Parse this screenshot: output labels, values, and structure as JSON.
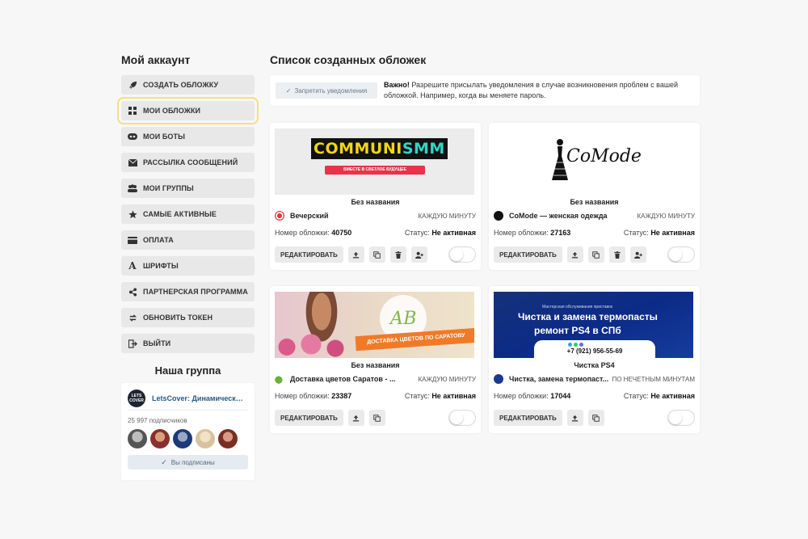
{
  "sidebar": {
    "title": "Мой аккаунт",
    "items": [
      {
        "label": "СОЗДАТЬ ОБЛОЖКУ",
        "icon": "rocket-icon"
      },
      {
        "label": "МОИ ОБЛОЖКИ",
        "icon": "grid-icon"
      },
      {
        "label": "МОИ БОТЫ",
        "icon": "bot-icon"
      },
      {
        "label": "РАССЫЛКА СООБЩЕНИЙ",
        "icon": "envelope-icon"
      },
      {
        "label": "МОИ ГРУППЫ",
        "icon": "users-icon"
      },
      {
        "label": "САМЫЕ АКТИВНЫЕ",
        "icon": "star-icon"
      },
      {
        "label": "ОПЛАТА",
        "icon": "card-icon"
      },
      {
        "label": "ШРИФТЫ",
        "icon": "font-icon"
      },
      {
        "label": "ПАРТНЕРСКАЯ ПРОГРАММА",
        "icon": "share-icon"
      },
      {
        "label": "ОБНОВИТЬ ТОКЕН",
        "icon": "refresh-icon"
      },
      {
        "label": "ВЫЙТИ",
        "icon": "logout-icon"
      }
    ],
    "active_index": 1
  },
  "group": {
    "title": "Наша группа",
    "logo_text": "LETS COVER",
    "name": "LetsCover: Динамические обложки",
    "subscribers": "25 997 подписчиков",
    "subscribed_label": "Вы подписаны"
  },
  "main": {
    "title": "Список созданных обложек",
    "notice_button": "Запретить уведомления",
    "notice_bold": "Важно!",
    "notice_text": " Разрешите присылать уведомления в случае возникновения проблем с вашей обложкой. Например, когда вы меняете пароль."
  },
  "card_labels": {
    "cover_number_label": "Номер обложки:",
    "status_label": "Статус:",
    "edit_button": "РЕДАКТИРОВАТЬ"
  },
  "cards": [
    {
      "name": "Без названия",
      "group": "Вечерский",
      "frequency": "КАЖДУЮ МИНУТУ",
      "number": "40750",
      "status": "Не активная",
      "active": false
    },
    {
      "name": "Без названия",
      "group": "CoMode — женская одежда",
      "frequency": "КАЖДУЮ МИНУТУ",
      "number": "27163",
      "status": "Не активная",
      "active": false
    },
    {
      "name": "Без названия",
      "group": "Доставка цветов Саратов - ...",
      "frequency": "КАЖДУЮ МИНУТУ",
      "number": "23387",
      "status": "Не активная",
      "active": false
    },
    {
      "name": "Чистка PS4",
      "group": "Чистка, замена термопаст...",
      "frequency": "ПО НЕЧЕТНЫМ МИНУТАМ",
      "number": "17044",
      "status": "Не активная",
      "active": false
    }
  ],
  "covers": {
    "c1_brand_a": "COMMUNI",
    "c1_brand_b": "SMM",
    "c1_ribbon": "ВМЕСТЕ В СВЕТЛОЕ БУДУЩЕЕ",
    "c2_logo": "CoMode",
    "c3_mark": "АВ",
    "c3_banner": "ДОСТАВКА ЦВЕТОВ ПО САРАТОВУ",
    "c4_small": "Мастерская обслуживания приставок",
    "c4_line1": "Чистка и замена термопасты",
    "c4_line2": "ремонт PS4 в СПб",
    "c4_phone": "+7 (921) 956-55-69"
  },
  "colors": {
    "accent_outline": "#f3e07a",
    "link": "#2a5885",
    "menu_bg": "#e8e8e8"
  }
}
